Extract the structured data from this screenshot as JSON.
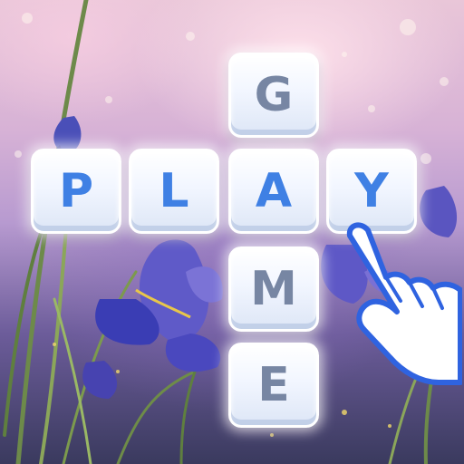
{
  "board": {
    "horizontal_word": [
      "P",
      "L",
      "A",
      "Y"
    ],
    "vertical_word": [
      "G",
      "A",
      "M",
      "E"
    ]
  },
  "colors": {
    "highlighted_letter": "#3f80e4",
    "inactive_letter": "#7786a3",
    "tile_face": "#f2f6ff",
    "hand_outline": "#2f63e0"
  },
  "icons": {
    "pointer": "tapping-hand-icon"
  }
}
